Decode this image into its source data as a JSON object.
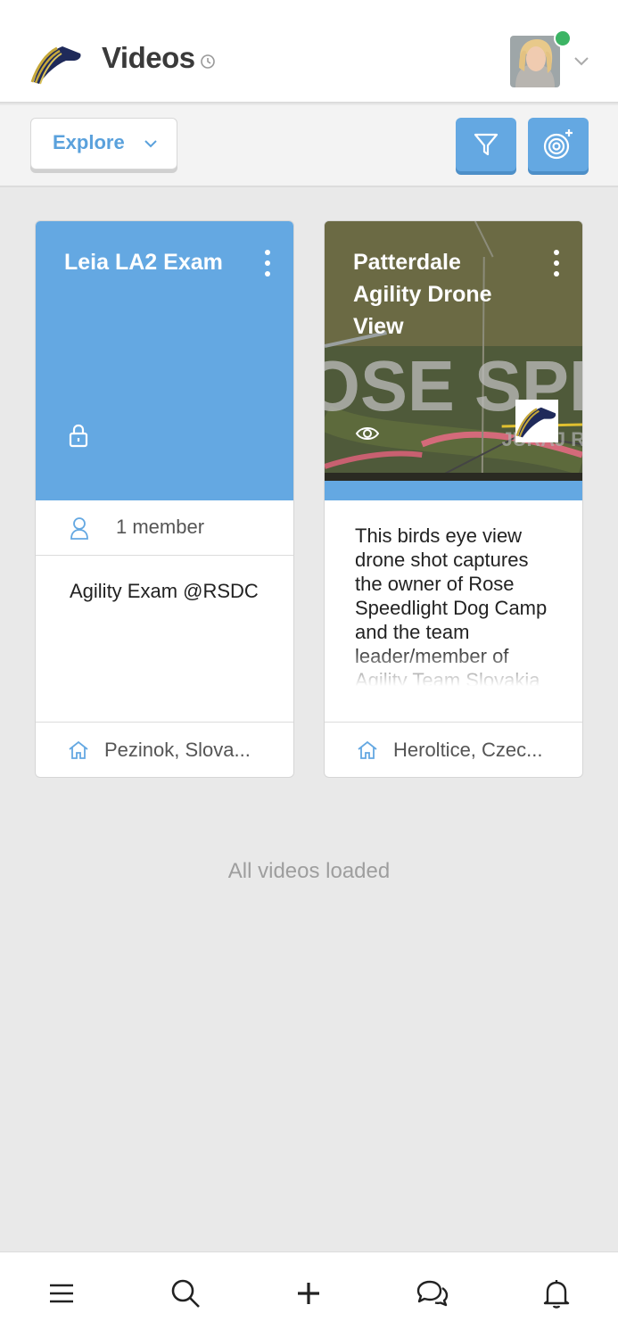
{
  "header": {
    "title": "Videos",
    "icons": {
      "logo": "app-logo",
      "history": "clock-icon",
      "avatar": "user-avatar",
      "status": "online-dot",
      "menu": "chevron-down-icon"
    }
  },
  "toolbar": {
    "explore_label": "Explore",
    "filter_icon": "filter-icon",
    "target_icon": "target-plus-icon"
  },
  "cards": [
    {
      "title": "Leia LA2 Exam",
      "lock_icon": "lock-icon",
      "members": "1 member",
      "description": "Agility Exam @RSDC",
      "location": "Pezinok, Slova..."
    },
    {
      "title": "Patterdale Agility Drone View",
      "visibility_icon": "eye-icon",
      "description": "This birds eye view drone shot captures the owner of Rose Speedlight Dog Camp and the team leader/member of Agility Team Slovakia and Patterdale",
      "location": "Heroltice, Czec...",
      "thumb_text": "OSE SPE",
      "thumb_watermark": "JURAJ R"
    }
  ],
  "status_text": "All videos loaded",
  "bottom_nav": [
    "menu-icon",
    "search-icon",
    "plus-icon",
    "chat-icon",
    "bell-icon"
  ],
  "colors": {
    "accent": "#64a8e2",
    "link": "#5aa1dc",
    "online": "#3cb464",
    "logo_gold": "#c6a83a",
    "logo_navy": "#1f2a5a"
  }
}
